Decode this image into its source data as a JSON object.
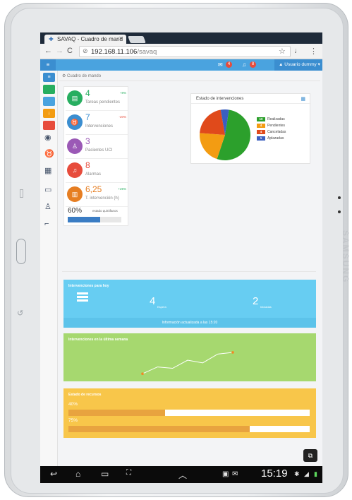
{
  "browser": {
    "tab_title": "SAVAQ - Cuadro de mand",
    "url_host": "192.168.11.106",
    "url_path": "/savaq"
  },
  "header": {
    "messages_count": "4",
    "alerts_count": "8",
    "user_label": "Usuario dummy"
  },
  "breadcrumb": "Cuadro de mando",
  "stats": [
    {
      "value": "4",
      "label": "Tareas pendientes",
      "delta": "+8%",
      "color": "#27ae60"
    },
    {
      "value": "7",
      "label": "Intervenciones",
      "delta": "-20%",
      "color": "#3b8ed0"
    },
    {
      "value": "3",
      "label": "Pacientes UCI",
      "delta": "",
      "color": "#9b59b6"
    },
    {
      "value": "8",
      "label": "Alarmas",
      "delta": "",
      "color": "#e74c3c"
    },
    {
      "value": "6,25",
      "label": "T. intervención (h)",
      "delta": "+25%",
      "color": "#e67e22"
    }
  ],
  "quirofano": {
    "percent_label": "60%",
    "label": "estado quirófanos",
    "fraction": 0.6
  },
  "intervenciones_card": {
    "title": "Estado de intervenciones",
    "legend": [
      {
        "count": "10",
        "label": "Realizadas",
        "color": "#2ca02c"
      },
      {
        "count": "4",
        "label": "Pendientes",
        "color": "#f39c12"
      },
      {
        "count": "4",
        "label": "Canceladas",
        "color": "#e04a1b"
      },
      {
        "count": "1",
        "label": "Aplazadas",
        "color": "#3b5fc0"
      }
    ]
  },
  "hoy_panel": {
    "title": "Intervenciones para hoy",
    "espera_count": "4",
    "espera_label": "Espera",
    "iniciadas_count": "2",
    "iniciadas_label": "Iniciadas",
    "updated": "Información actualizada a las 15:20"
  },
  "semana_panel": {
    "title": "Intervenciones en la última semana"
  },
  "recursos_panel": {
    "title": "Estado de recursos",
    "bars": [
      {
        "label": "40%",
        "fraction": 0.4
      },
      {
        "label": "75%",
        "fraction": 0.75
      }
    ]
  },
  "chart_data": {
    "type": "line",
    "title": "Intervenciones en la última semana",
    "x": [
      1,
      2,
      3,
      4,
      5,
      6,
      7
    ],
    "y": [
      1,
      3,
      2.6,
      5,
      4.2,
      6.8,
      7.3
    ],
    "xlabel": "",
    "ylabel": "",
    "ylim": [
      0,
      10
    ],
    "grid": false
  },
  "pie_data": {
    "type": "pie",
    "values": [
      10,
      4,
      4,
      1
    ],
    "colors": [
      "#2ca02c",
      "#f39c12",
      "#e04a1b",
      "#3b5fc0"
    ]
  },
  "status_bar": {
    "clock": "15:19"
  },
  "brand": "SAMSUNG"
}
